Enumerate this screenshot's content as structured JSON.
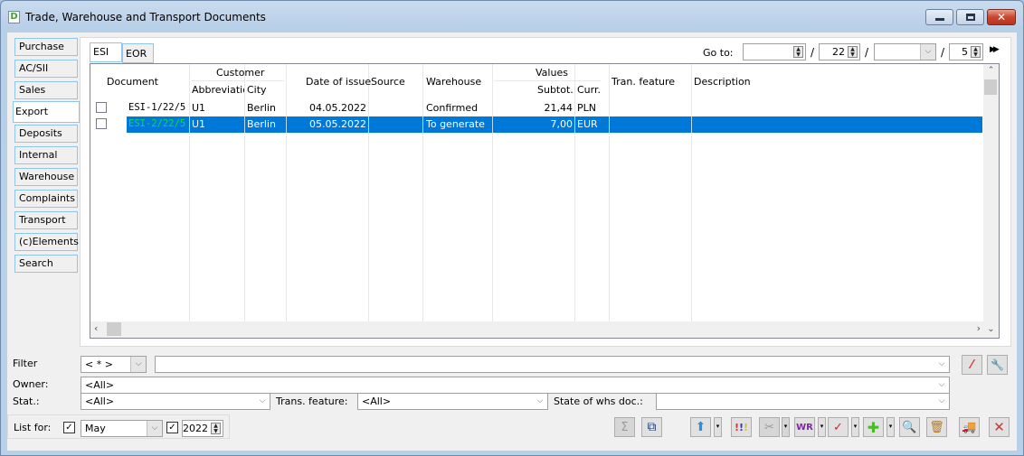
{
  "window": {
    "title": "Trade, Warehouse and Transport Documents",
    "app_icon": "D",
    "controls": {
      "minimize": "minimize-icon",
      "maximize": "maximize-icon",
      "close": "✕"
    }
  },
  "sidebar": {
    "items": [
      {
        "label": "Purchase"
      },
      {
        "label": "AC/SII"
      },
      {
        "label": "Sales"
      },
      {
        "label": "Export",
        "active": true
      },
      {
        "label": "Deposits"
      },
      {
        "label": "Internal"
      },
      {
        "label": "Warehouse"
      },
      {
        "label": "Complaints"
      },
      {
        "label": "Transport"
      },
      {
        "label": "(c)Elements"
      },
      {
        "label": "Search"
      }
    ]
  },
  "tabs": [
    {
      "label": "ESI",
      "active": true
    },
    {
      "label": "EOR"
    }
  ],
  "goto": {
    "label": "Go to:",
    "field1": "",
    "field2": "22",
    "field3": "",
    "field4": "5",
    "separator": "/"
  },
  "grid": {
    "headers": {
      "document": "Document",
      "customer": "Customer",
      "abbreviation": "Abbreviation",
      "city": "City",
      "date_of_issue": "Date of issue",
      "source": "Source",
      "warehouse": "Warehouse",
      "values": "Values",
      "subtotal": "Subtot.",
      "currency": "Curr.",
      "tran_feature": "Tran. feature",
      "description": "Description"
    },
    "rows": [
      {
        "document": "ESI-1/22/5",
        "abbreviation": "U1",
        "city": "Berlin",
        "date": "04.05.2022",
        "source": "",
        "warehouse": "Confirmed",
        "subtotal": "21,44",
        "currency": "PLN",
        "tran_feature": "",
        "description": "",
        "selected": false
      },
      {
        "document": "ESI-2/22/5",
        "abbreviation": "U1",
        "city": "Berlin",
        "date": "05.05.2022",
        "source": "",
        "warehouse": "To generate",
        "subtotal": "7,00",
        "currency": "EUR",
        "tran_feature": "",
        "description": "",
        "selected": true
      }
    ],
    "selected_doc_color": "#00e04a",
    "selection_color": "#0078d7"
  },
  "filters": {
    "filter_label": "Filter",
    "filter_combo": "< * >",
    "filter_text": "",
    "owner_label": "Owner:",
    "owner_value": "<All>",
    "stat_label": "Stat.:",
    "stat_value": "<All>",
    "trans_feature_label": "Trans. feature:",
    "trans_feature_value": "<All>",
    "whs_state_label": "State of whs doc.:",
    "whs_state_value": ""
  },
  "list_for": {
    "label": "List for:",
    "month_checked": true,
    "month": "May",
    "year_checked": true,
    "year": "2022"
  },
  "toolbar": {
    "sum": "Σ",
    "check": "✓",
    "close": "✕",
    "add": "✚"
  }
}
